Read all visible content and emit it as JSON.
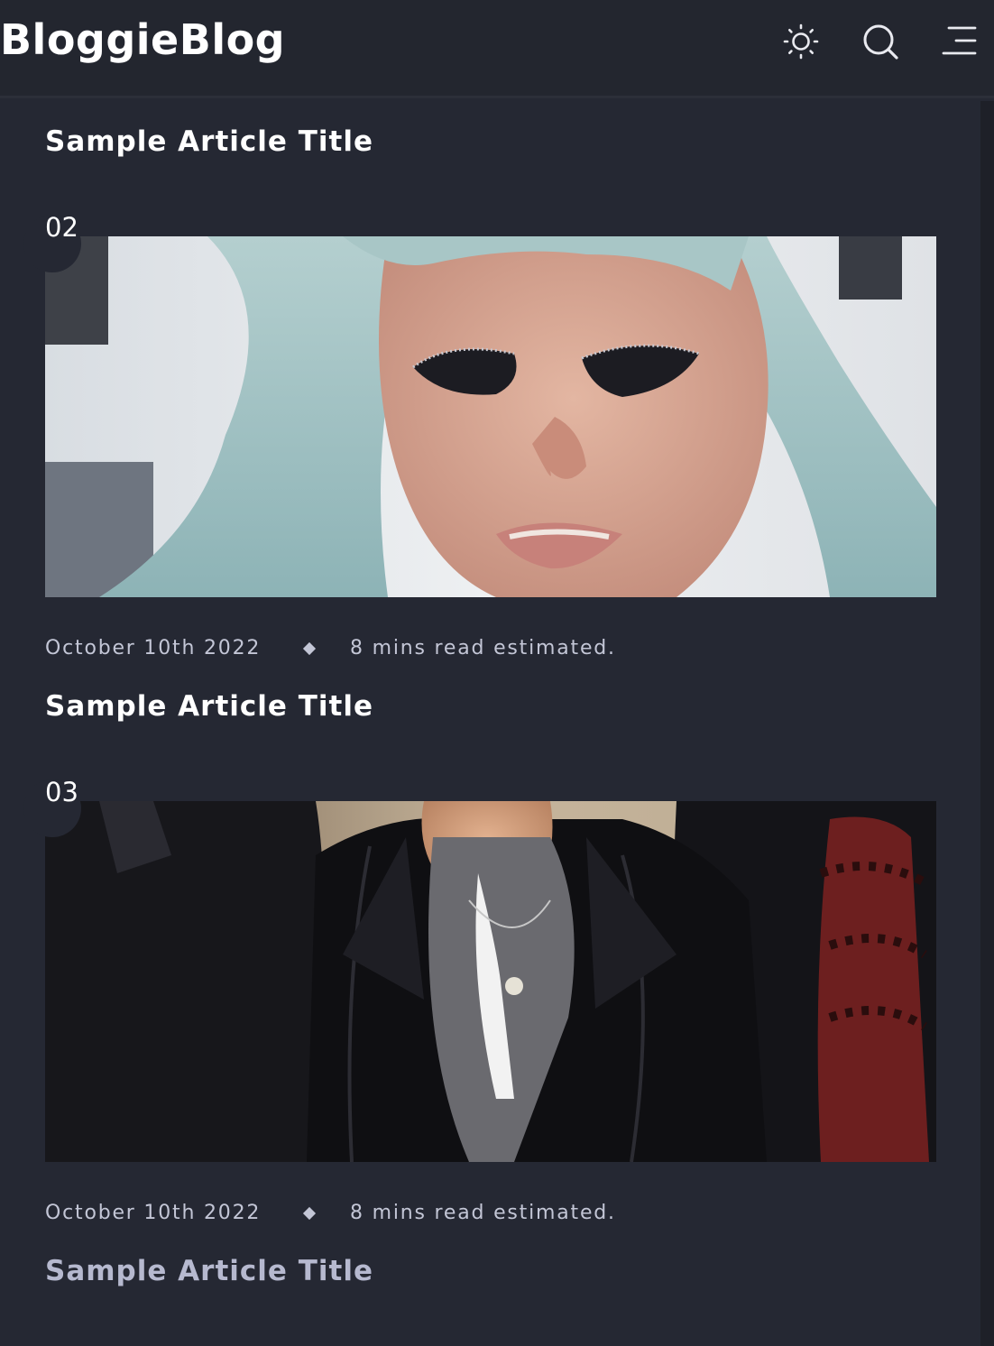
{
  "header": {
    "logo": "BloggieBlog",
    "icons": [
      "sun-icon",
      "search-icon",
      "menu-icon"
    ]
  },
  "articles": [
    {
      "title": "Sample Article Title"
    },
    {
      "number": "02",
      "image": "portrait-woman-blue-hair",
      "date": "October 10th 2022",
      "read_time": "8 mins read estimated.",
      "title": "Sample Article Title"
    },
    {
      "number": "03",
      "image": "band-leather-jackets",
      "date": "October 10th 2022",
      "read_time": "8 mins read estimated.",
      "title": "Sample Article Title"
    }
  ],
  "colors": {
    "background": "#252833",
    "header_bg": "#23262f",
    "title": "#ffffff",
    "title_faded": "#b6b9cf",
    "meta": "#c3c6d6"
  }
}
